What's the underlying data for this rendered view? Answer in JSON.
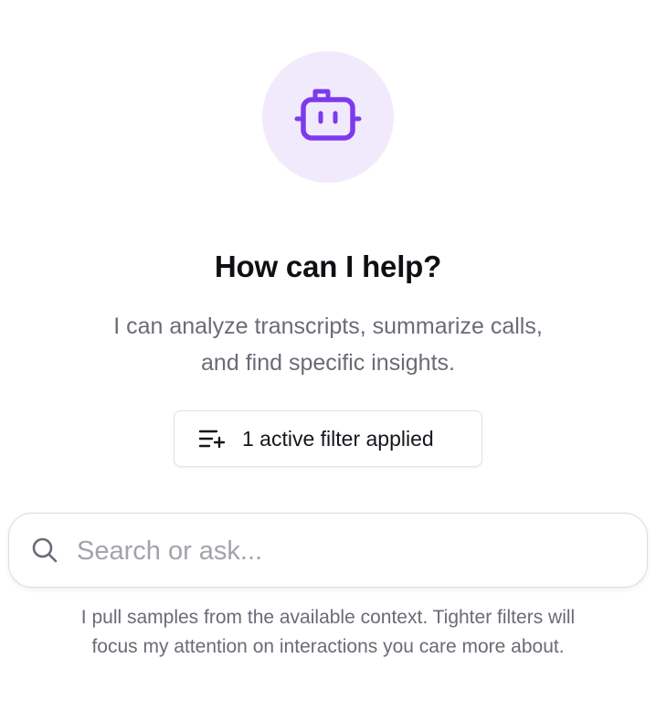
{
  "assistant": {
    "avatar_icon": "robot-icon",
    "accent_color": "#7c3aed",
    "avatar_background": "#f1eafd"
  },
  "hero": {
    "title": "How can I help?",
    "subtitle_lines": [
      "I can analyze transcripts, summarize calls,",
      "and find specific insights."
    ]
  },
  "filter": {
    "icon": "filter-list-plus-icon",
    "label": "1 active filter applied"
  },
  "search": {
    "icon": "search-icon",
    "placeholder": "Search or ask...",
    "value": ""
  },
  "footnote": {
    "lines": [
      "I pull samples from the available context. Tighter filters will",
      "focus my attention on interactions you care more about."
    ]
  }
}
